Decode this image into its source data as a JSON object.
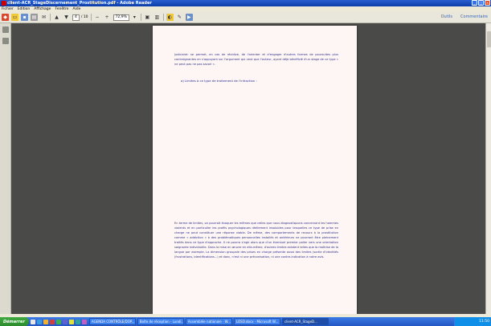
{
  "window": {
    "title": "client-ACR_StageDiscernement_Prostitution.pdf - Adobe Reader"
  },
  "menu": [
    "Fichier",
    "Edition",
    "Affichage",
    "Fenêtre",
    "Aide"
  ],
  "toolbar": {
    "page_current": "4",
    "page_total": "/ 10",
    "zoom": "72,9%",
    "tools_label": "Outils",
    "comment_label": "Commentaire"
  },
  "document": {
    "paragraph1": "judiciaire: se permet, en cas de récidive, de l'orienter et d'engager d'autres formes de poursuites plus contraignantes en s'appuyant sur l'argument qui veut que l'auteur, ayant déjà bénéficié d'un stage de ce type « ne peut pas ne pas savoir ».",
    "heading": "a)   Limites à ce type de traitement de l'infraction :",
    "paragraph2": "En terme de limites, on pourrait évoquer les mêmes que celles que nous diagnostiquons concernant les hommes violents et en particulier les profils psychologiques réellement insolubles pour lesquelles ce type de prise en charge ne peut constituer une réponse viable. De même, des comportements de recours à la prostitution comme « addiction » à des problématiques personnelles installés et antérieurs ne pourront être pleinement traités dans ce type d'approche. Il ne pourra s'agir alors que d'un éventuel premier palier vers une orientation soignante individuelle. Dans la mise en œuvre en elle-même, d'autres limites existent telles que la maîtrise de la langue par exemple. La dimension groupale des prises en charge présente aussi des limites (sortie d'identités (frustrations, identifications...) et donc, n'est ni une préconisation, ni une contre-indication à notre avis."
  },
  "taskbar": {
    "start_label": "Démarrer",
    "tasks": [
      {
        "label": "AGENDA CONTRÔLE/DOP..."
      },
      {
        "label": "Boîte de réception - Lundi..."
      },
      {
        "label": "Assemblée nationale - W..."
      },
      {
        "label": "LOSO.docx - Microsoft W..."
      },
      {
        "label": "client-ACR_StageD..."
      }
    ],
    "clock": "11:50"
  },
  "colors": {
    "titlebar": "#0a3da8",
    "taskbar": "#2457c4",
    "doc_background": "#4a4a48",
    "page": "#fdf6f4",
    "text": "#2e2e8a",
    "link": "#3a68b0"
  }
}
